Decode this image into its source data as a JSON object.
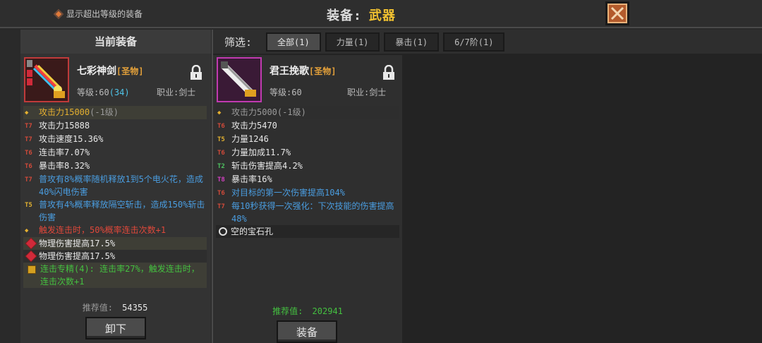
{
  "header": {
    "toggle_label": "显示超出等级的装备",
    "title_prefix": "装备:",
    "title_value": "武器"
  },
  "left_panel": {
    "heading": "当前装备",
    "item": {
      "name": "七彩神剑",
      "grade": "[圣物]",
      "level_label": "等级:60",
      "level_bonus": "(34)",
      "job": "职业:剑士",
      "stats": [
        {
          "tier": "",
          "text": "攻击力15000",
          "suffix": "(-1级)",
          "style": "gold",
          "shade": "shade"
        },
        {
          "tier": "T7",
          "text": "攻击力15888",
          "style": "white"
        },
        {
          "tier": "T7",
          "text": "攻击速度15.36%",
          "style": "white"
        },
        {
          "tier": "T6",
          "text": "连击率7.07%",
          "style": "white"
        },
        {
          "tier": "T6",
          "text": "暴击率8.32%",
          "style": "white"
        },
        {
          "tier": "T7",
          "text": "普攻有8%概率随机释放1到5个电火花，造成40%闪电伤害",
          "style": "blue"
        },
        {
          "tier": "T5",
          "text": "普攻有4%概率释放隔空斩击，造成150%斩击伤害",
          "style": "blue"
        },
        {
          "tier": "",
          "text": "触发连击时，50%概率连击次数+1",
          "style": "red"
        }
      ],
      "gems": [
        "物理伤害提高17.5%",
        "物理伤害提高17.5%"
      ],
      "set_bonus": "连击专精(4): 连击率27%，触发连击时，连击次数+1"
    },
    "score_label": "推荐值:",
    "score_value": "54355",
    "button_label": "卸下"
  },
  "filter": {
    "label": "筛选:",
    "chips": [
      "全部(1)",
      "力量(1)",
      "暴击(1)",
      "6/7阶(1)"
    ]
  },
  "candidate": {
    "item": {
      "name": "君王挽歌",
      "grade": "[圣物]",
      "level_label": "等级:60",
      "job": "职业:剑士",
      "stats": [
        {
          "tier": "",
          "text": "攻击力5000",
          "suffix": "(-1级)",
          "style": "grey",
          "shade": "shade2"
        },
        {
          "tier": "T6",
          "text": "攻击力5470",
          "style": "white"
        },
        {
          "tier": "T5",
          "text": "力量1246",
          "style": "white"
        },
        {
          "tier": "T6",
          "text": "力量加成11.7%",
          "style": "white"
        },
        {
          "tier": "T2",
          "text": "斩击伤害提高4.2%",
          "style": "white"
        },
        {
          "tier": "T8",
          "text": "暴击率16%",
          "style": "white"
        },
        {
          "tier": "T6",
          "text": "对目标的第一次伤害提高104%",
          "style": "blue"
        },
        {
          "tier": "T7",
          "text": "每10秒获得一次强化：下次技能的伤害提高48%",
          "style": "blue"
        }
      ],
      "socket": "空的宝石孔"
    },
    "score_label": "推荐值:",
    "score_value": "202941",
    "button_label": "装备"
  },
  "colors": {
    "accent_gold": "#f2c230",
    "close_button": "#b35b2c",
    "score_green": "#44c040"
  }
}
